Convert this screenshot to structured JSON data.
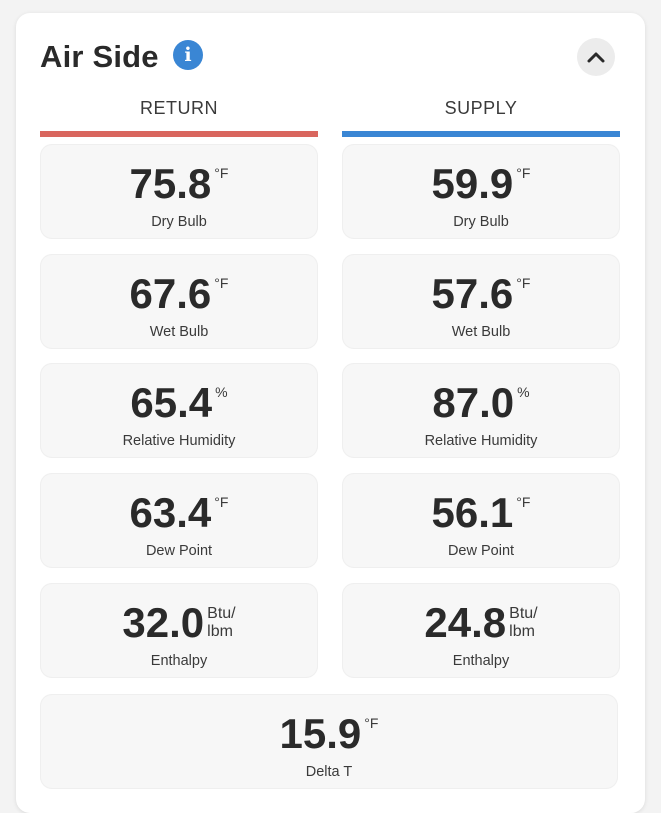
{
  "section": {
    "title": "Air Side",
    "info_icon": "info-icon",
    "collapse_icon": "chevron-up-icon"
  },
  "colors": {
    "return_bar": "#d9665e",
    "supply_bar": "#3a86d4"
  },
  "columns": {
    "return": {
      "label": "RETURN",
      "metrics": [
        {
          "value": "75.8",
          "unit": "°F",
          "label": "Dry Bulb"
        },
        {
          "value": "67.6",
          "unit": "°F",
          "label": "Wet Bulb"
        },
        {
          "value": "65.4",
          "unit": "%",
          "label": "Relative Humidity"
        },
        {
          "value": "63.4",
          "unit": "°F",
          "label": "Dew Point"
        },
        {
          "value": "32.0",
          "unit": "Btu/\nlbm",
          "label": "Enthalpy"
        }
      ]
    },
    "supply": {
      "label": "SUPPLY",
      "metrics": [
        {
          "value": "59.9",
          "unit": "°F",
          "label": "Dry Bulb"
        },
        {
          "value": "57.6",
          "unit": "°F",
          "label": "Wet Bulb"
        },
        {
          "value": "87.0",
          "unit": "%",
          "label": "Relative Humidity"
        },
        {
          "value": "56.1",
          "unit": "°F",
          "label": "Dew Point"
        },
        {
          "value": "24.8",
          "unit": "Btu/\nlbm",
          "label": "Enthalpy"
        }
      ]
    }
  },
  "delta_t": {
    "value": "15.9",
    "unit": "°F",
    "label": "Delta T"
  }
}
